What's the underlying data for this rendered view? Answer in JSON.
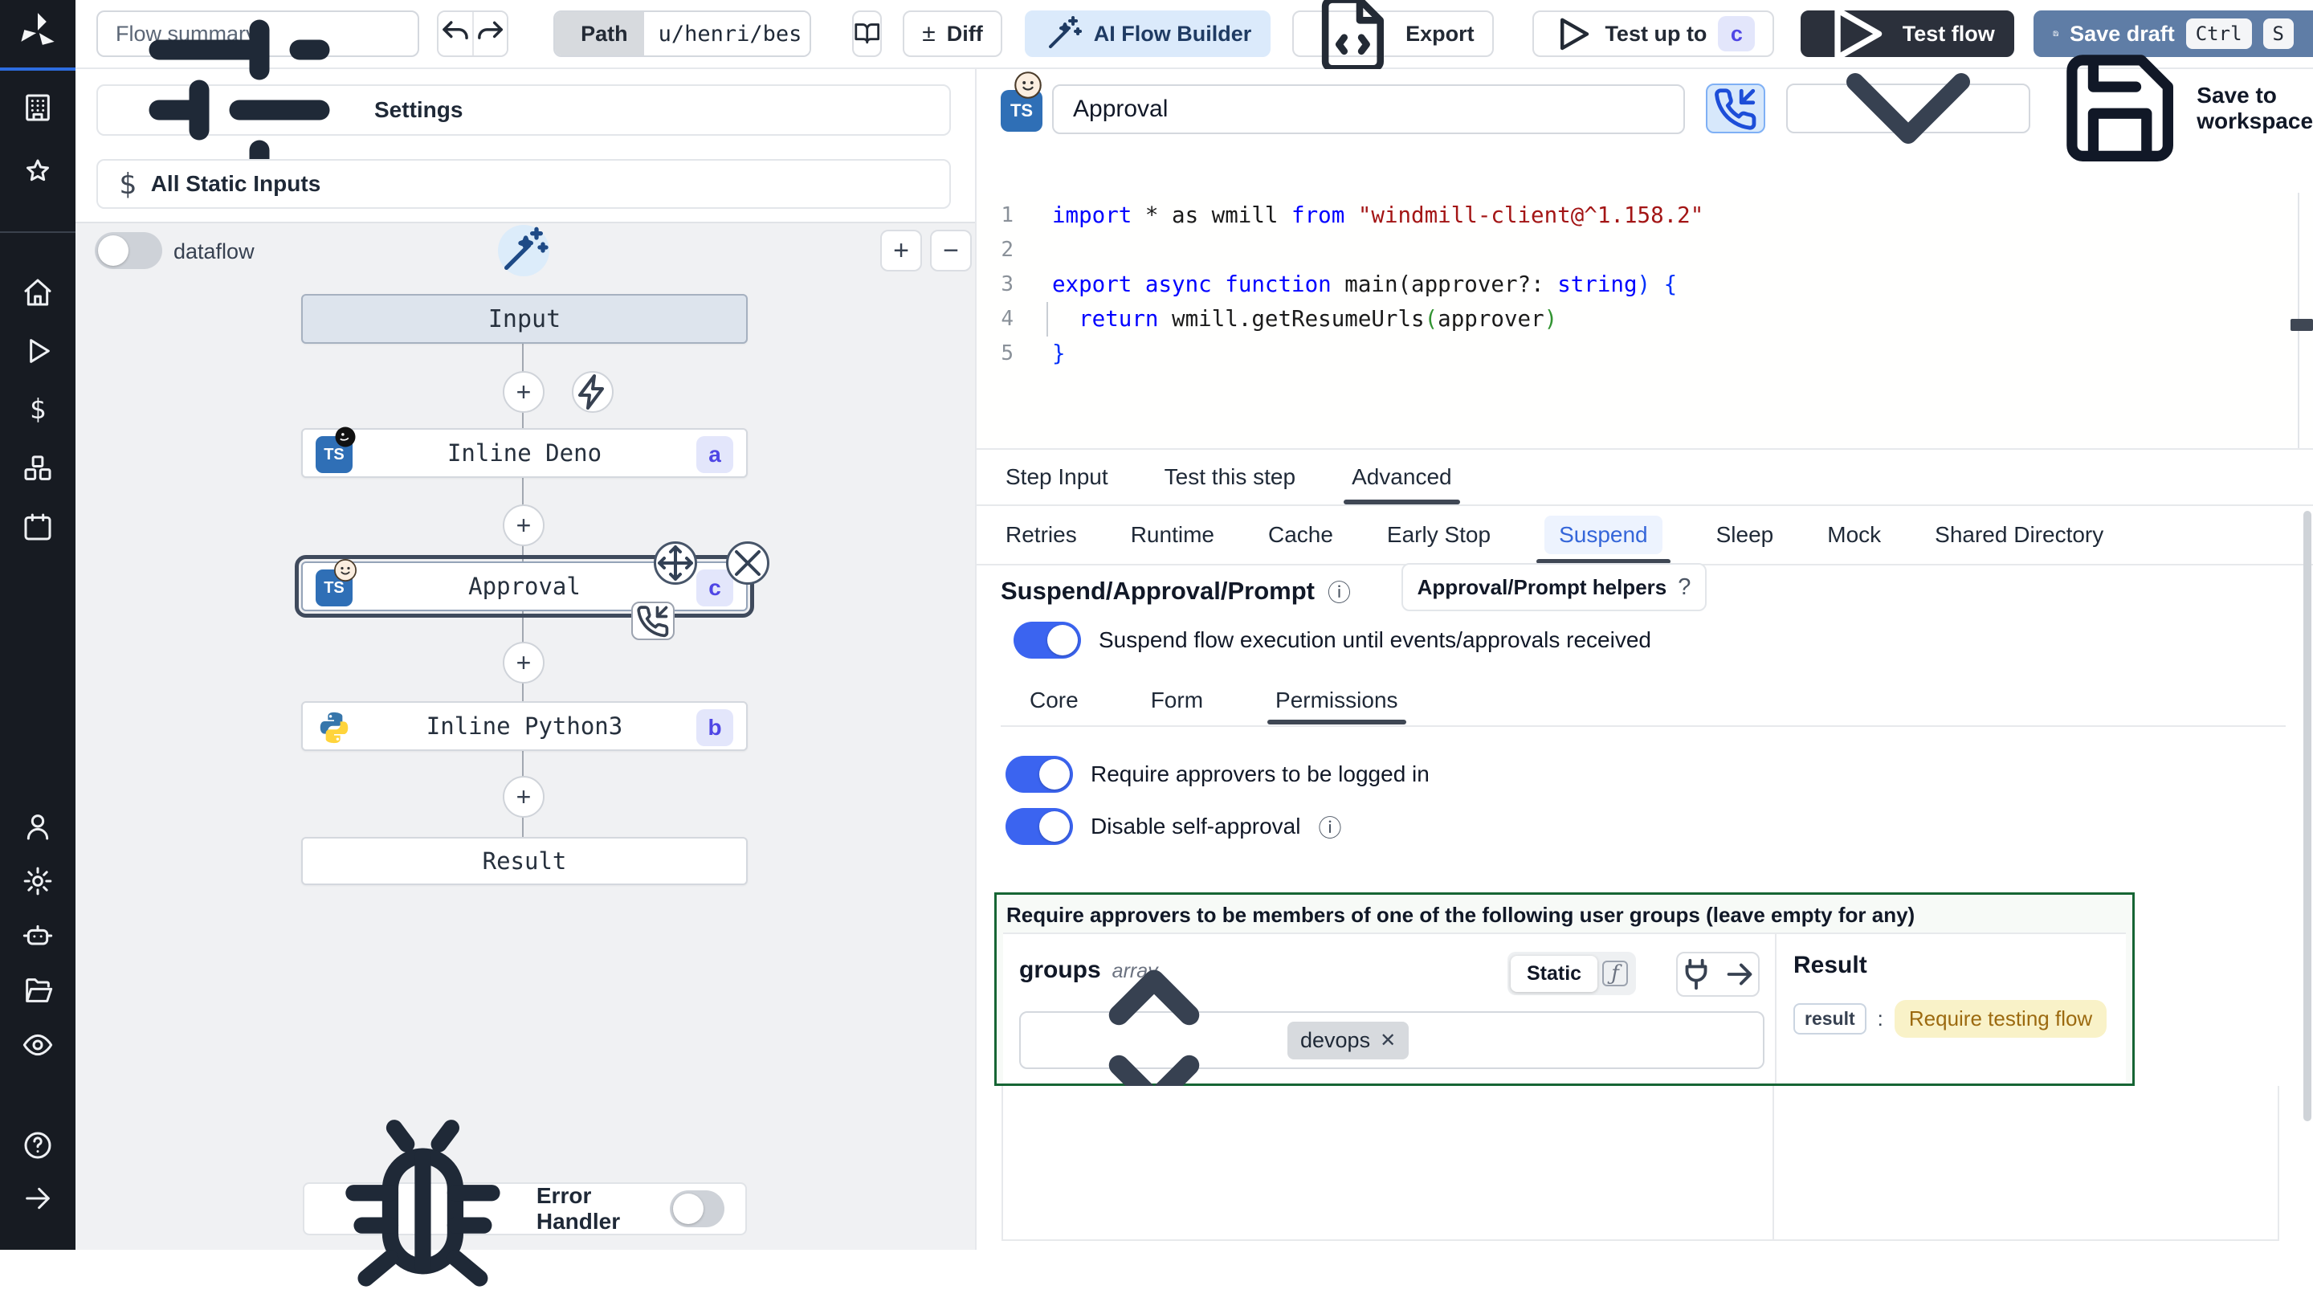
{
  "colors": {
    "accent_blue": "#3b64f0",
    "save_draft_blue": "#5f7da6",
    "dark_button": "#2b303b",
    "ai_builder_bg": "#dbeafb",
    "green_border": "#166534",
    "badge_bg": "#e3e6fb",
    "badge_text": "#4f46e5",
    "yellow_pill_bg": "#f9f2c8",
    "yellow_pill_text": "#9c6a10",
    "suspend_tab_blue": "#3566d9",
    "status_dot_green": "#5ad17e"
  },
  "sidebar": {
    "top": [
      {
        "icon": "building-icon"
      },
      {
        "icon": "star-icon"
      }
    ],
    "main": [
      {
        "icon": "home-icon"
      },
      {
        "icon": "play-icon"
      },
      {
        "icon": "dollar-icon"
      },
      {
        "icon": "boxes-icon"
      },
      {
        "icon": "calendar-icon"
      }
    ],
    "lower": [
      {
        "icon": "user-icon"
      },
      {
        "icon": "gear-icon"
      },
      {
        "icon": "robot-icon"
      },
      {
        "icon": "folder-icon"
      },
      {
        "icon": "eye-icon"
      }
    ],
    "bottom": [
      {
        "icon": "help-icon"
      },
      {
        "icon": "arrow-right-icon"
      }
    ]
  },
  "topbar": {
    "flow_summary_placeholder": "Flow summary",
    "path_label": "Path",
    "path_value": "u/henri/bes",
    "diff_symbol": "±",
    "diff_label": "Diff",
    "ai_flow_builder_label": "AI Flow Builder",
    "export_label": "Export",
    "test_up_to_label": "Test up to",
    "test_up_to_badge": "c",
    "test_flow_label": "Test flow",
    "save_draft_label": "Save draft",
    "save_kbd": [
      "Ctrl",
      "S"
    ]
  },
  "flow_panel": {
    "settings_label": "Settings",
    "all_static_inputs_label": "All Static Inputs",
    "dataflow_label": "dataflow",
    "zoom_in": "+",
    "zoom_out": "−",
    "nodes": {
      "input": {
        "label": "Input"
      },
      "deno": {
        "label": "Inline Deno",
        "badge": "a",
        "icon_text": "TS"
      },
      "approval": {
        "label": "Approval",
        "badge": "c",
        "icon_text": "TS"
      },
      "python": {
        "label": "Inline Python3",
        "badge": "b"
      },
      "result": {
        "label": "Result"
      }
    },
    "error_handler_label": "Error Handler"
  },
  "step_panel": {
    "ts_label": "TS",
    "title_value": "Approval",
    "save_to_workspace_label": "Save to workspace",
    "toolbar_icons": [
      {
        "icon": "status-dot-icon",
        "style": "dot"
      },
      {
        "icon": "dollar-icon",
        "style": "dollar"
      },
      {
        "icon": "dollar-icon",
        "style": "dollar"
      },
      {
        "icon": "package-icon",
        "style": ""
      },
      {
        "icon": "refresh-icon",
        "style": ""
      },
      {
        "icon": "tag-icon",
        "style": ""
      },
      {
        "icon": "magic-wand-icon",
        "style": "active"
      },
      {
        "icon": "magic-wand-off-icon",
        "style": "muted"
      }
    ],
    "code_lines": [
      {
        "n": "1",
        "tokens": [
          [
            "import",
            "kw"
          ],
          [
            " * as wmill ",
            "pl"
          ],
          [
            "from",
            "kw"
          ],
          [
            " ",
            "pl"
          ],
          [
            "\"windmill-client@^1.158.2\"",
            "str"
          ]
        ]
      },
      {
        "n": "2",
        "tokens": []
      },
      {
        "n": "3",
        "tokens": [
          [
            "export",
            "kw"
          ],
          [
            " ",
            "pl"
          ],
          [
            "async",
            "kw"
          ],
          [
            " ",
            "pl"
          ],
          [
            "function",
            "kw"
          ],
          [
            " main(approver?: ",
            "pl"
          ],
          [
            "string",
            "kw"
          ],
          [
            ") {",
            "br1"
          ]
        ]
      },
      {
        "n": "4",
        "tokens": [
          [
            "  ",
            "pl"
          ],
          [
            "return",
            "kw"
          ],
          [
            " wmill.getResumeUrls",
            "pl"
          ],
          [
            "(",
            "br2"
          ],
          [
            "approver",
            "pl"
          ],
          [
            ")",
            "br2"
          ]
        ]
      },
      {
        "n": "5",
        "tokens": [
          [
            "}",
            "br1"
          ]
        ]
      }
    ],
    "tabs": {
      "items": [
        "Step Input",
        "Test this step",
        "Advanced"
      ],
      "active": "Advanced"
    },
    "advanced_tabs": {
      "items": [
        "Retries",
        "Runtime",
        "Cache",
        "Early Stop",
        "Suspend",
        "Sleep",
        "Mock",
        "Shared Directory"
      ],
      "active": "Suspend"
    },
    "suspend": {
      "heading": "Suspend/Approval/Prompt",
      "helpers_button_label": "Approval/Prompt helpers",
      "suspend_toggle_label": "Suspend flow execution until events/approvals received",
      "sub_tabs": {
        "items": [
          "Core",
          "Form",
          "Permissions"
        ],
        "active": "Permissions"
      },
      "require_logged_in_label": "Require approvers to be logged in",
      "disable_self_approval_label": "Disable self-approval",
      "groups_box_title": "Require approvers to be members of one of the following user groups (leave empty for any)",
      "field_name": "groups",
      "field_type": "array",
      "static_label": "Static",
      "fn_symbol": "ƒ",
      "chip_label": "devops",
      "chip_remove": "✕",
      "result_heading": "Result",
      "result_key": "result",
      "result_colon": ":",
      "result_value": "Require testing flow"
    }
  }
}
